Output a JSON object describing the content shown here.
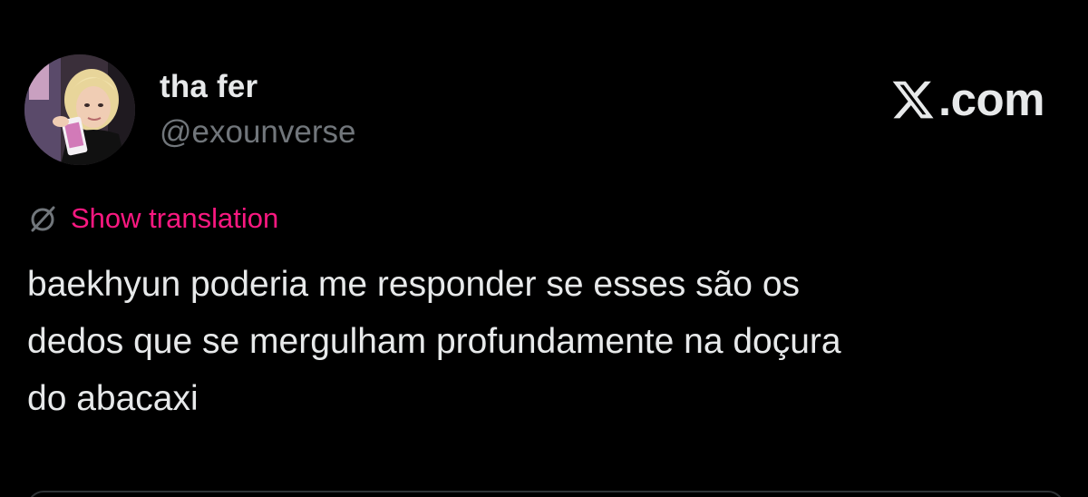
{
  "author": {
    "display_name": "tha fer",
    "handle": "@exounverse",
    "avatar_icon": "profile-photo"
  },
  "brand": {
    "icon": "x-logo-icon",
    "domain": ".com"
  },
  "translation": {
    "icon": "translate-icon",
    "label": "Show translation",
    "color": "#f91880"
  },
  "tweet": {
    "lines": [
      "baekhyun poderia me responder se esses são os",
      "dedos que se mergulham profundamente na doçura",
      "do abacaxi"
    ]
  },
  "colors": {
    "background": "#000000",
    "primary_text": "#e7e9ea",
    "secondary_text": "#71767b",
    "accent": "#f91880",
    "border": "#2f3336"
  }
}
